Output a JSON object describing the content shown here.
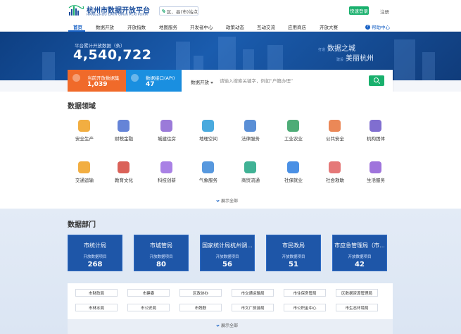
{
  "header": {
    "brand_cn": "杭州市数据开放平台",
    "brand_en": "HANGZHOU DATA OPEN PLATFORM",
    "region": "区、县(市)站点",
    "login": "快速登录",
    "register": "注册"
  },
  "nav": {
    "items": [
      "首页",
      "数据开放",
      "开放指数",
      "地图服务",
      "开发者中心",
      "政策动态",
      "互动交流",
      "应用商店",
      "开放大赛"
    ],
    "help": "帮助中心"
  },
  "banner": {
    "label": "平台累计开放数据（条）",
    "count": "4,540,722",
    "slogan1_tag": "打造",
    "slogan1": "数据之城",
    "slogan2_tag": "建设",
    "slogan2": "美丽杭州"
  },
  "stats": [
    {
      "label": "当前开放数据集",
      "value": "1,039"
    },
    {
      "label": "数据接口(API)",
      "value": "47"
    }
  ],
  "search": {
    "type": "数据开放",
    "placeholder": "请输入搜索关键字，例如“户籍办理”"
  },
  "domains": {
    "title": "数据领域",
    "row1": [
      "安全生产",
      "财税金融",
      "城建住房",
      "地理空间",
      "法律服务",
      "工业农业",
      "公共安全",
      "机构团体"
    ],
    "row2": [
      "交通运输",
      "教育文化",
      "科技创新",
      "气象服务",
      "商贸流通",
      "社保就业",
      "社会救助",
      "生活服务"
    ],
    "show_all": "展示全部"
  },
  "departments": {
    "title": "数据部门",
    "cards": [
      {
        "name": "市统计局",
        "sub": "开放数据项目",
        "count": "268"
      },
      {
        "name": "市城管局",
        "sub": "开放数据项目",
        "count": "80"
      },
      {
        "name": "国家统计局杭州调...",
        "sub": "开放数据项目",
        "count": "56"
      },
      {
        "name": "市民政局",
        "sub": "开放数据项目",
        "count": "51"
      },
      {
        "name": "市应急管理局（市...",
        "sub": "开放数据项目",
        "count": "42"
      }
    ],
    "list_row1": [
      "市财政局",
      "市建委",
      "区政协办",
      "市交通运输局",
      "市住保房管局",
      "区数据资源管理局"
    ],
    "list_row2": [
      "市林水局",
      "市公安局",
      "市残联",
      "市文广旅游局",
      "市公积金中心",
      "市生态环境局"
    ],
    "show_all": "展示全部"
  },
  "colors": {
    "primary": "#1a63c6",
    "green": "#19b06d",
    "orange": "#f06a2a",
    "blue": "#1a8fe0",
    "dept_card": "#1e56a8"
  }
}
